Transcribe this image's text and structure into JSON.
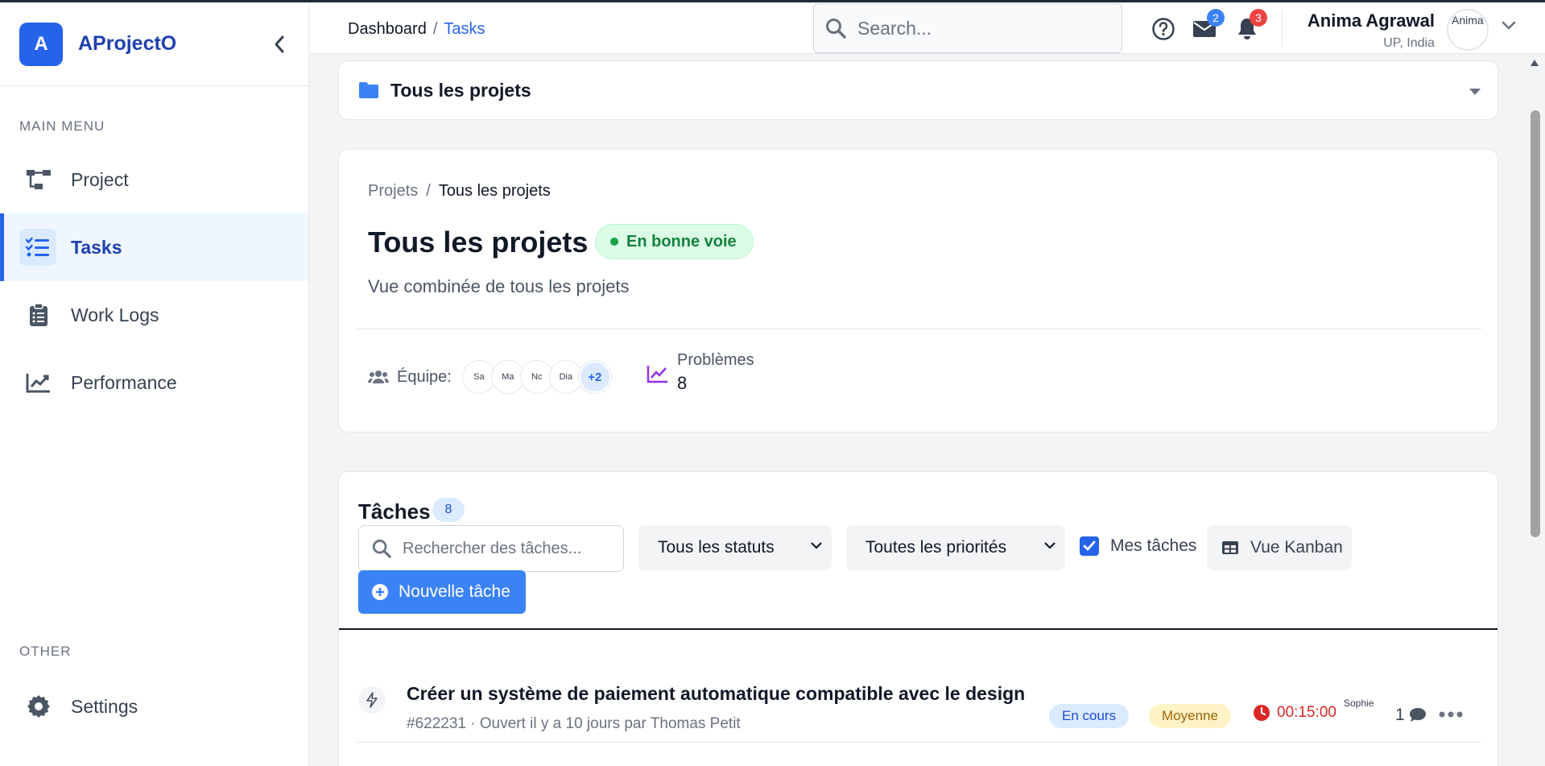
{
  "brand": {
    "logo_letter": "A",
    "name": "AProjectO"
  },
  "sidebar": {
    "main_menu_label": "MAIN MENU",
    "main_items": [
      {
        "label": "Project",
        "icon": "project-tree-icon",
        "active": false
      },
      {
        "label": "Tasks",
        "icon": "task-list-icon",
        "active": true
      },
      {
        "label": "Work Logs",
        "icon": "clipboard-icon",
        "active": false
      },
      {
        "label": "Performance",
        "icon": "chart-line-icon",
        "active": false
      }
    ],
    "other_label": "OTHER",
    "other_items": [
      {
        "label": "Settings",
        "icon": "gear-icon"
      }
    ]
  },
  "header": {
    "breadcrumb": [
      "Dashboard",
      "Tasks"
    ],
    "search_placeholder": "Search...",
    "messages_count": "2",
    "notifications_count": "3",
    "user_name": "Anima Agrawal",
    "user_location": "UP, India",
    "user_avatar_alt": "Anima"
  },
  "project_selector": {
    "label": "Tous les projets"
  },
  "overview": {
    "breadcrumb": [
      "Projets",
      "Tous les projets"
    ],
    "title": "Tous les projets",
    "status": "En bonne voie",
    "description": "Vue combinée de tous les projets",
    "team_label": "Équipe:",
    "team_avatars_alt": [
      "Sa",
      "Ma",
      "Nc",
      "Dia"
    ],
    "team_more": "+2",
    "issues_label": "Problèmes",
    "issues_count": "8"
  },
  "tasks": {
    "title": "Tâches",
    "count": "8",
    "search_placeholder": "Rechercher des tâches...",
    "status_filter": "Tous les statuts",
    "priority_filter": "Toutes les priorités",
    "my_tasks_label": "Mes tâches",
    "my_tasks_checked": true,
    "kanban_label": "Vue Kanban",
    "new_task_label": "Nouvelle tâche",
    "rows": [
      {
        "title": "Créer un système de paiement automatique compatible avec le design",
        "meta": "#622231 · Ouvert il y a 10 jours par Thomas Petit",
        "status": "En cours",
        "priority": "Moyenne",
        "time": "00:15:00",
        "assignee_alt": "Sophie",
        "comments": "1"
      }
    ]
  },
  "colors": {
    "accent": "#2563eb",
    "status_green": "#15803d",
    "timer_red": "#dc2626",
    "priority_yellow": "#a16207"
  }
}
